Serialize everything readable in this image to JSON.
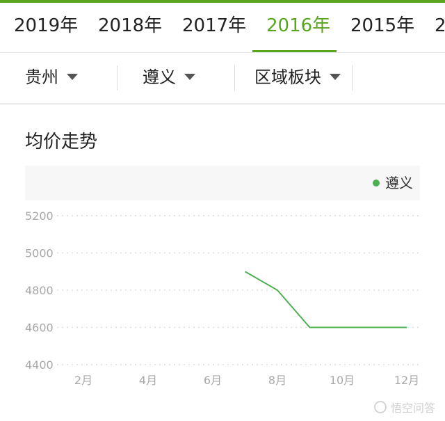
{
  "colors": {
    "accent": "#5aa51e",
    "series": "#4caf50"
  },
  "years": {
    "tabs": [
      "2019年",
      "2018年",
      "2017年",
      "2016年",
      "2015年",
      "2"
    ],
    "active_index": 3
  },
  "filters": {
    "province": "贵州",
    "city": "遵义",
    "region": "区域板块"
  },
  "section": {
    "title": "均价走势"
  },
  "chart_data": {
    "type": "line",
    "title": "",
    "xlabel": "",
    "ylabel": "",
    "x_ticks": [
      "2月",
      "4月",
      "6月",
      "8月",
      "10月",
      "12月"
    ],
    "y_ticks": [
      "5200",
      "5000",
      "4800",
      "4600",
      "4400"
    ],
    "ylim": [
      4400,
      5200
    ],
    "xlim": [
      1,
      12
    ],
    "grid": "horizontal dotted",
    "legend": "top-right",
    "series": [
      {
        "name": "遵义",
        "x": [
          7,
          8,
          9,
          12
        ],
        "y": [
          4900,
          4800,
          4600,
          4600
        ]
      }
    ]
  },
  "watermark": {
    "text": "悟空问答"
  }
}
